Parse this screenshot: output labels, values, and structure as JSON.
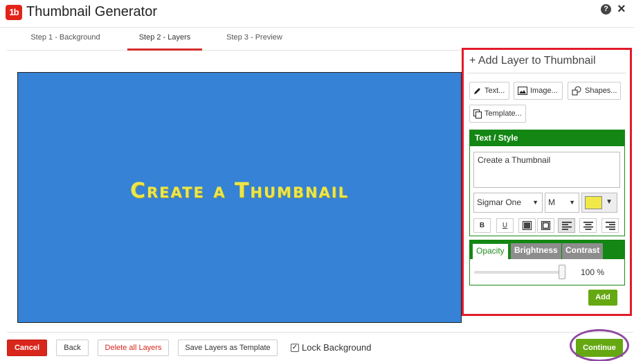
{
  "app": {
    "title": "Thumbnail Generator",
    "logo_text": "1b",
    "help_glyph": "?",
    "close_glyph": "×"
  },
  "tabs": [
    {
      "label": "Step 1 - Background"
    },
    {
      "label": "Step 2 - Layers"
    },
    {
      "label": "Step 3 - Preview"
    }
  ],
  "canvas": {
    "text": "Create a Thumbnail",
    "background_color": "#3582d6",
    "text_color": "#ece64a"
  },
  "panel": {
    "title": "+ Add Layer to Thumbnail",
    "buttons": {
      "text": "Text...",
      "image": "Image...",
      "shapes": "Shapes...",
      "template": "Template..."
    },
    "text_style": {
      "header": "Text / Style",
      "text_value": "Create a Thumbnail",
      "font": "Sigmar One",
      "size": "M",
      "color": "#f1e84a",
      "bold_label": "B",
      "underline_label": "U",
      "arrow_glyph": "▼"
    },
    "effects": {
      "tabs": [
        "Opacity",
        "Brightness",
        "Contrast"
      ],
      "value": "100 %",
      "level_percent": 100
    },
    "add_label": "Add"
  },
  "footer": {
    "cancel": "Cancel",
    "back": "Back",
    "delete_all": "Delete all Layers",
    "save_template": "Save Layers as Template",
    "lock_background": "Lock Background",
    "lock_checked_glyph": "✓",
    "continue": "Continue"
  },
  "colors": {
    "accent_red": "#d9261c",
    "panel_green": "#138613",
    "button_green": "#65a812",
    "highlight_purple": "#8f4aa0"
  }
}
